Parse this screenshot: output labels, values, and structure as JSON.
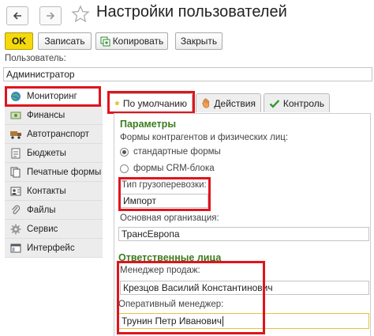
{
  "window": {
    "title": "Настройки пользователей"
  },
  "toolbar": {
    "ok_label": "OK",
    "save_label": "Записать",
    "copy_label": "Копировать",
    "close_label": "Закрыть"
  },
  "user": {
    "label": "Пользователь:",
    "value": "Администратор"
  },
  "sidebar": {
    "items": [
      {
        "label": "Мониторинг",
        "icon": "globe-icon"
      },
      {
        "label": "Финансы",
        "icon": "money-icon"
      },
      {
        "label": "Автотранспорт",
        "icon": "truck-icon"
      },
      {
        "label": "Бюджеты",
        "icon": "document-icon"
      },
      {
        "label": "Печатные формы",
        "icon": "print-forms-icon"
      },
      {
        "label": "Контакты",
        "icon": "contacts-icon"
      },
      {
        "label": "Файлы",
        "icon": "paperclip-icon"
      },
      {
        "label": "Сервис",
        "icon": "gear-icon"
      },
      {
        "label": "Интерфейс",
        "icon": "interface-icon"
      }
    ]
  },
  "tabs": [
    {
      "label": "По умолчанию",
      "icon": "star-icon"
    },
    {
      "label": "Действия",
      "icon": "hand-icon"
    },
    {
      "label": "Контроль",
      "icon": "checkmark-icon"
    }
  ],
  "params": {
    "section_title": "Параметры",
    "forms_label": "Формы контрагентов и физических лиц:",
    "radio_standard": "стандартные формы",
    "radio_crm": "формы CRM-блока",
    "cargo_type_label": "Тип грузоперевозки:",
    "cargo_type_value": "Импорт",
    "org_label": "Основная организация:",
    "org_value": "ТрансЕвропа"
  },
  "responsible": {
    "section_title": "Ответственные лица",
    "sales_manager_label": "Менеджер продаж:",
    "sales_manager_value": "Крезцов Василий Константинович",
    "operative_manager_label": "Оперативный менеджер:",
    "operative_manager_value": "Трунин Петр Иванович"
  },
  "colors": {
    "accent_green": "#3a7d1e",
    "highlight_red": "#e0141d",
    "ok_yellow": "#f5d90a"
  }
}
